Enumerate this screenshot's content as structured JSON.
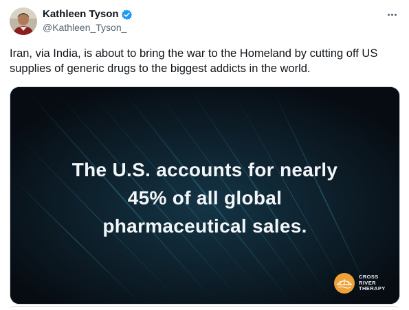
{
  "author": {
    "display_name": "Kathleen Tyson",
    "handle": "@Kathleen_Tyson_",
    "verified": true,
    "verified_color": "#1d9bf0"
  },
  "tweet": {
    "text": "Iran, via India, is about to bring the war to the Homeland by cutting off US supplies of generic drugs to the biggest addicts in the world."
  },
  "media": {
    "headline_lines": [
      "The U.S. accounts for nearly",
      "45% of all global",
      "pharmaceutical sales."
    ],
    "logo": {
      "lines": [
        "CROSS",
        "RIVER",
        "THERAPY"
      ],
      "color": "#f0a13a"
    },
    "background_color": "#0a1017",
    "accent_color": "#1f5f73"
  },
  "icons": {
    "more": "more-options-icon",
    "verified": "verified-badge-icon"
  }
}
